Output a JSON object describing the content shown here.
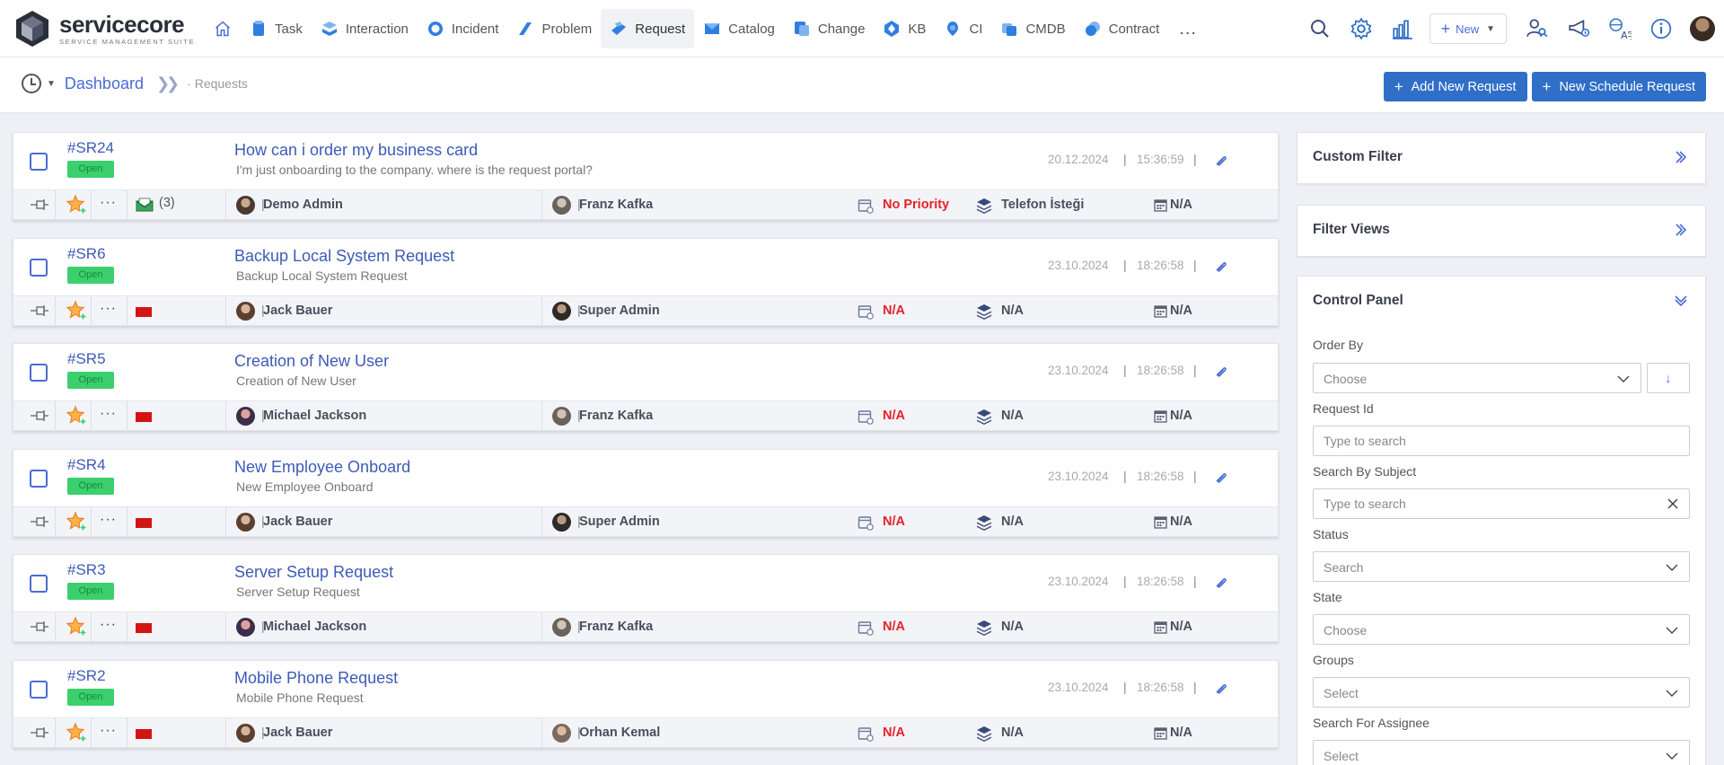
{
  "brand": {
    "name_part1": "service",
    "name_part2": "core",
    "subtitle": "SERVICE MANAGEMENT SUITE"
  },
  "nav": {
    "items": [
      {
        "label": "Task",
        "icon": "task-icon"
      },
      {
        "label": "Interaction",
        "icon": "interaction-icon"
      },
      {
        "label": "Incident",
        "icon": "incident-icon"
      },
      {
        "label": "Problem",
        "icon": "problem-icon"
      },
      {
        "label": "Request",
        "icon": "request-icon",
        "active": true
      },
      {
        "label": "Catalog",
        "icon": "catalog-icon"
      },
      {
        "label": "Change",
        "icon": "change-icon"
      },
      {
        "label": "KB",
        "icon": "kb-icon"
      },
      {
        "label": "CI",
        "icon": "ci-icon"
      },
      {
        "label": "CMDB",
        "icon": "cmdb-icon"
      },
      {
        "label": "Contract",
        "icon": "contract-icon"
      }
    ],
    "more": "...",
    "new_label": "New"
  },
  "breadcrumb": {
    "root": "Dashboard",
    "current": "Requests"
  },
  "actions": {
    "add_request": "Add New Request",
    "new_schedule": "New Schedule Request"
  },
  "requests": [
    {
      "id": "#SR24",
      "status": "Open",
      "title": "How can i order my business card",
      "description": "I'm just onboarding to the company. where is the request portal?",
      "date": "20.12.2024",
      "time": "15:36:59",
      "mail_count": "(3)",
      "requester": "Demo Admin",
      "assignee": "Franz Kafka",
      "priority": "No Priority",
      "category": "Telefon İsteği",
      "sla": "N/A",
      "has_mail": true
    },
    {
      "id": "#SR6",
      "status": "Open",
      "title": "Backup Local System Request",
      "description": "Backup Local System Request",
      "date": "23.10.2024",
      "time": "18:26:58",
      "requester": "Jack Bauer",
      "assignee": "Super Admin",
      "priority": "N/A",
      "category": "N/A",
      "sla": "N/A",
      "has_mail": false
    },
    {
      "id": "#SR5",
      "status": "Open",
      "title": "Creation of New User",
      "description": "Creation of New User",
      "date": "23.10.2024",
      "time": "18:26:58",
      "requester": "Michael Jackson",
      "assignee": "Franz Kafka",
      "priority": "N/A",
      "category": "N/A",
      "sla": "N/A",
      "has_mail": false
    },
    {
      "id": "#SR4",
      "status": "Open",
      "title": "New Employee Onboard",
      "description": "New Employee Onboard",
      "date": "23.10.2024",
      "time": "18:26:58",
      "requester": "Jack Bauer",
      "assignee": "Super Admin",
      "priority": "N/A",
      "category": "N/A",
      "sla": "N/A",
      "has_mail": false
    },
    {
      "id": "#SR3",
      "status": "Open",
      "title": "Server Setup Request",
      "description": "Server Setup Request",
      "date": "23.10.2024",
      "time": "18:26:58",
      "requester": "Michael Jackson",
      "assignee": "Franz Kafka",
      "priority": "N/A",
      "category": "N/A",
      "sla": "N/A",
      "has_mail": false
    },
    {
      "id": "#SR2",
      "status": "Open",
      "title": "Mobile Phone Request",
      "description": "Mobile Phone Request",
      "date": "23.10.2024",
      "time": "18:26:58",
      "requester": "Jack Bauer",
      "assignee": "Orhan Kemal",
      "priority": "N/A",
      "category": "N/A",
      "sla": "N/A",
      "has_mail": false
    }
  ],
  "side": {
    "custom_filter": "Custom Filter",
    "filter_views": "Filter Views",
    "control_panel": "Control Panel",
    "order_by_label": "Order By",
    "order_by_value": "Choose",
    "sort_arrow": "↓",
    "request_id_label": "Request Id",
    "request_id_placeholder": "Type to search",
    "subject_label": "Search By Subject",
    "subject_placeholder": "Type to search",
    "status_label": "Status",
    "status_value": "Search",
    "state_label": "State",
    "state_value": "Choose",
    "groups_label": "Groups",
    "groups_value": "Select",
    "assignee_label": "Search For Assignee",
    "assignee_value": "Select"
  },
  "colors": {
    "accent": "#3d5bb8",
    "button": "#2f6fc7",
    "open_badge": "#3ccf6d",
    "priority_alert": "#e5222a",
    "flag": "#d41414"
  }
}
